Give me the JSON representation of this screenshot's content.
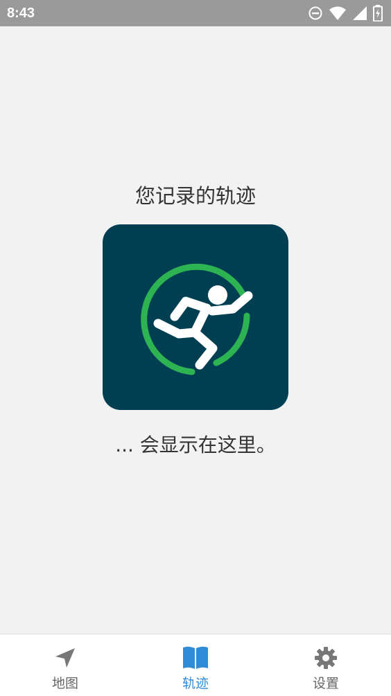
{
  "status_bar": {
    "time": "8:43",
    "icons": [
      "do-not-disturb-icon",
      "wifi-icon",
      "signal-icon",
      "battery-charging-icon"
    ]
  },
  "main": {
    "headline": "您记录的轨迹",
    "subline": "... 会显示在这里。",
    "logo_icon": "runner-app-logo"
  },
  "bottom_nav": {
    "items": [
      {
        "label": "地图",
        "icon": "navigation-arrow-icon",
        "active": false
      },
      {
        "label": "轨迹",
        "icon": "book-icon",
        "active": true
      },
      {
        "label": "设置",
        "icon": "gear-icon",
        "active": false
      }
    ]
  },
  "colors": {
    "status_bar": "#9a9a9a",
    "background": "#f2f2f2",
    "logo_bg": "#003e52",
    "logo_ring": "#2db351",
    "accent": "#2f8bd8"
  }
}
